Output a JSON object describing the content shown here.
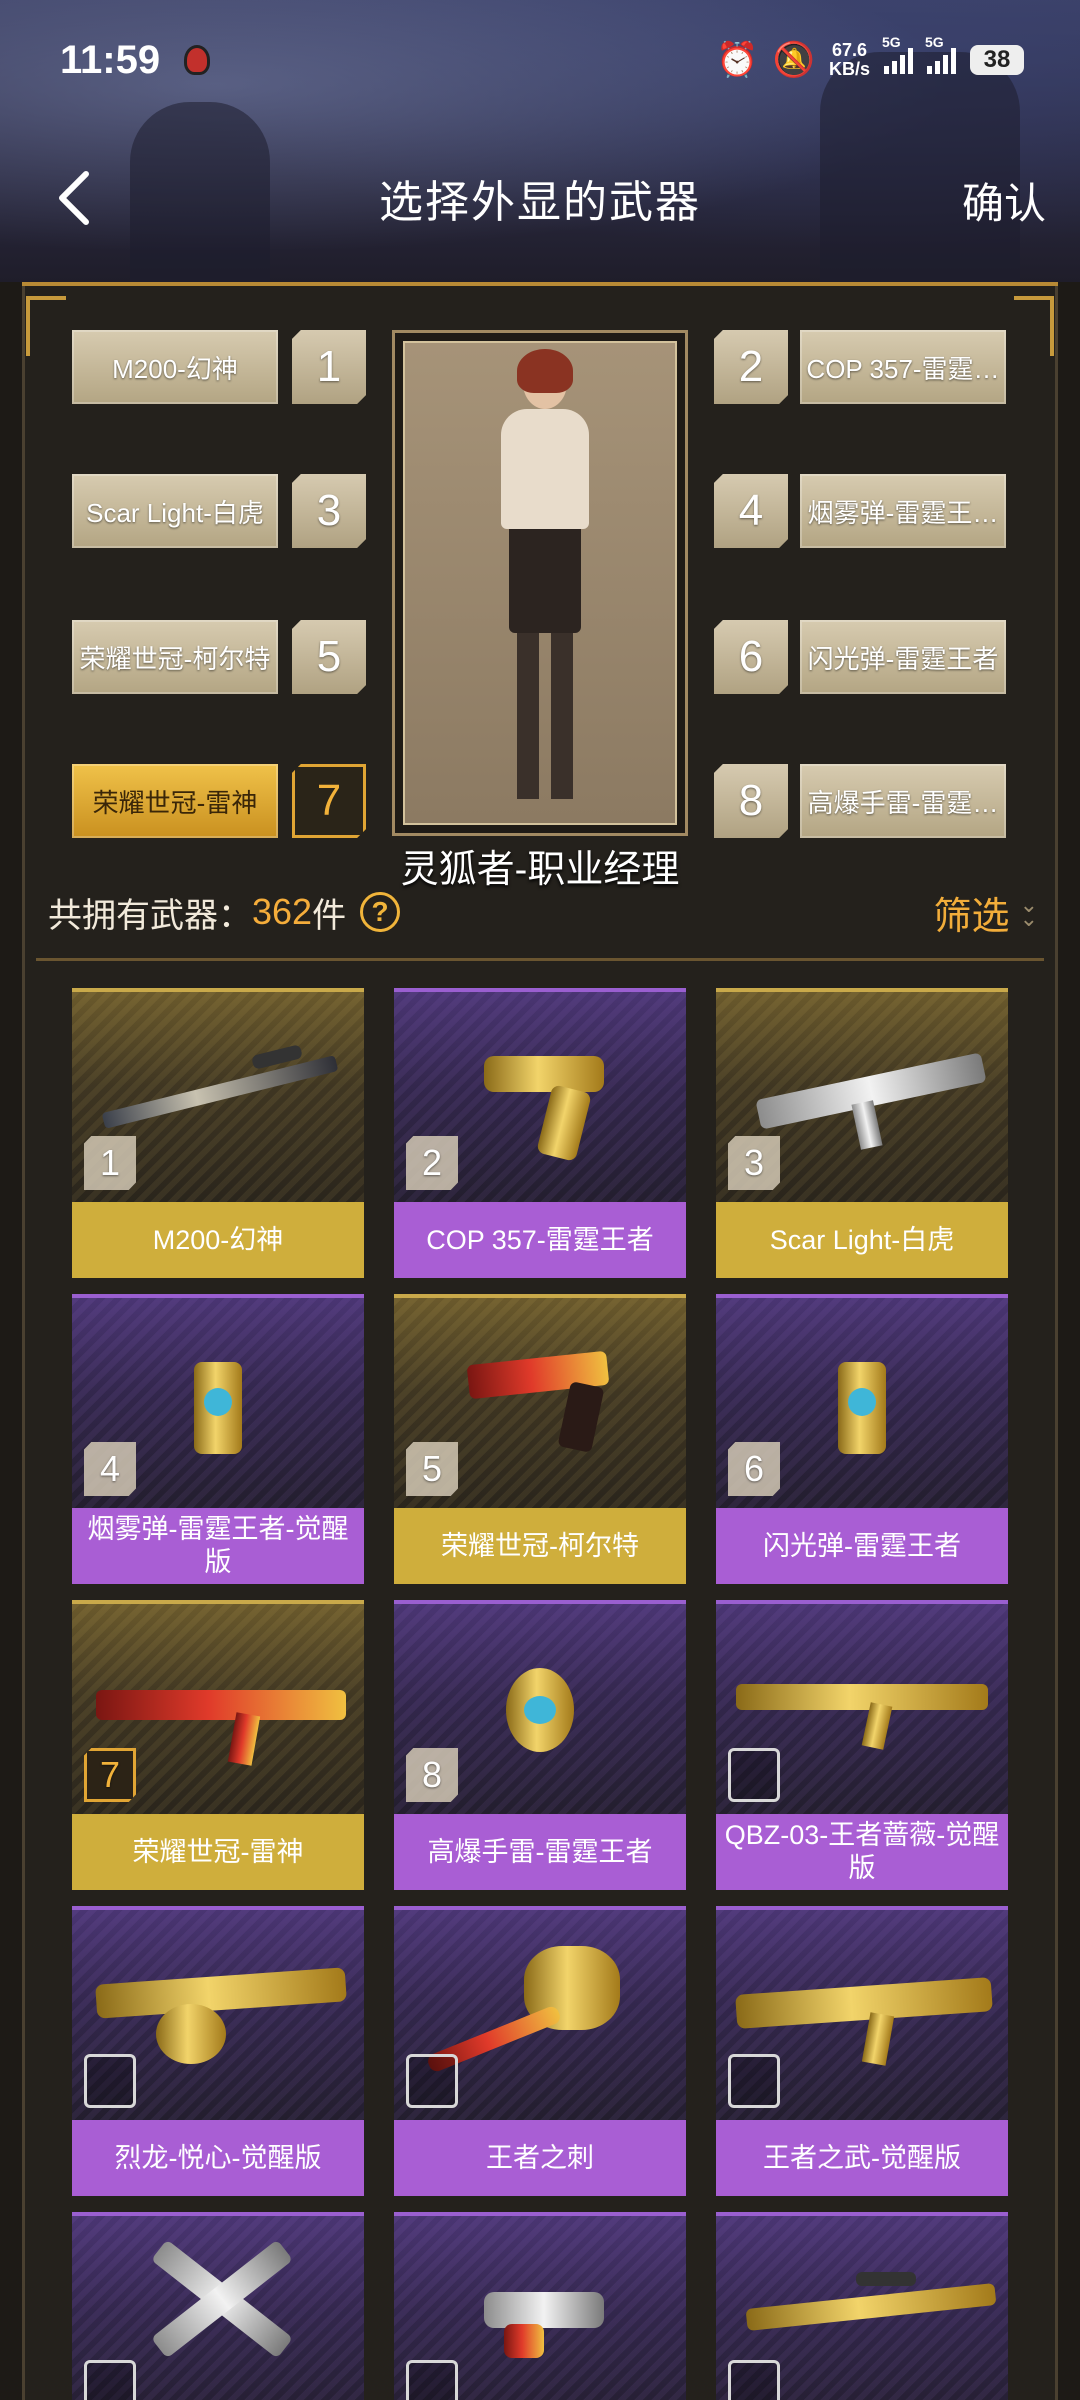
{
  "status_bar": {
    "time": "11:59",
    "net_speed_value": "67.6",
    "net_speed_unit": "KB/s",
    "signal1_label": "5G",
    "signal2_label": "5G",
    "battery": "38"
  },
  "header": {
    "title": "选择外显的武器",
    "confirm_label": "确认"
  },
  "loadout": {
    "character_name": "灵狐者-职业经理",
    "slots": [
      {
        "num": "1",
        "name": "M200-幻神"
      },
      {
        "num": "2",
        "name": "COP 357-雷霆…"
      },
      {
        "num": "3",
        "name": "Scar Light-白虎"
      },
      {
        "num": "4",
        "name": "烟雾弹-雷霆王…"
      },
      {
        "num": "5",
        "name": "荣耀世冠-柯尔特"
      },
      {
        "num": "6",
        "name": "闪光弹-雷霆王者"
      },
      {
        "num": "7",
        "name": "荣耀世冠-雷神"
      },
      {
        "num": "8",
        "name": "高爆手雷-雷霆…"
      }
    ]
  },
  "summary": {
    "count_label": "共拥有武器：",
    "count_value": "362",
    "count_unit": "件",
    "help_glyph": "?",
    "filter_label": "筛选"
  },
  "weapons": [
    {
      "name": "M200-幻神",
      "badge": "1",
      "rarity": "gold"
    },
    {
      "name": "COP 357-雷霆王者",
      "badge": "2",
      "rarity": "purple"
    },
    {
      "name": "Scar Light-白虎",
      "badge": "3",
      "rarity": "gold"
    },
    {
      "name": "烟雾弹-雷霆王者-觉醒版",
      "badge": "4",
      "rarity": "purple"
    },
    {
      "name": "荣耀世冠-柯尔特",
      "badge": "5",
      "rarity": "gold"
    },
    {
      "name": "闪光弹-雷霆王者",
      "badge": "6",
      "rarity": "purple"
    },
    {
      "name": "荣耀世冠-雷神",
      "badge": "7",
      "rarity": "gold"
    },
    {
      "name": "高爆手雷-雷霆王者",
      "badge": "8",
      "rarity": "purple"
    },
    {
      "name": "QBZ-03-王者蔷薇-觉醒版",
      "badge": "",
      "rarity": "purple"
    },
    {
      "name": "烈龙-悦心-觉醒版",
      "badge": "",
      "rarity": "purple"
    },
    {
      "name": "王者之刺",
      "badge": "",
      "rarity": "purple"
    },
    {
      "name": "王者之武-觉醒版",
      "badge": "",
      "rarity": "purple"
    },
    {
      "name": "",
      "badge": "",
      "rarity": "purple"
    },
    {
      "name": "",
      "badge": "",
      "rarity": "purple"
    },
    {
      "name": "",
      "badge": "",
      "rarity": "purple"
    }
  ],
  "colors": {
    "accent_orange": "#f5ad3b",
    "gold_card": "#cfae3c",
    "purple_card": "#a95ed4"
  },
  "icons": {
    "back": "chevron-left-icon",
    "help": "question-circle-icon",
    "filter": "chevron-down-icon",
    "alarm": "alarm-icon",
    "mute": "bell-off-icon"
  }
}
